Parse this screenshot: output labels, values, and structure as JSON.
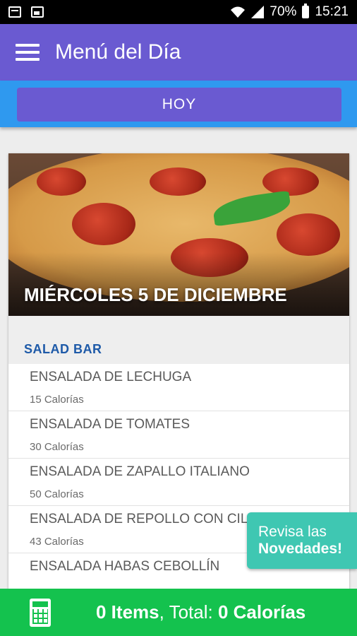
{
  "status_bar": {
    "battery": "70%",
    "time": "15:21"
  },
  "app_bar": {
    "title": "Menú del Día"
  },
  "tab": {
    "label": "HOY"
  },
  "hero": {
    "date": "MIÉRCOLES 5 DE DICIEMBRE"
  },
  "section": {
    "title": "SALAD BAR",
    "items": [
      {
        "name": "ENSALADA DE LECHUGA",
        "calories": "15 Calorías"
      },
      {
        "name": "ENSALADA DE TOMATES",
        "calories": "30 Calorías"
      },
      {
        "name": "ENSALADA DE ZAPALLO ITALIANO",
        "calories": "50 Calorías"
      },
      {
        "name": "ENSALADA DE REPOLLO CON CILANT",
        "calories": "43 Calorías"
      },
      {
        "name": "ENSALADA HABAS CEBOLLÍN",
        "calories": ""
      }
    ]
  },
  "news_button": {
    "line1": "Revisa las",
    "line2": "Novedades!"
  },
  "bottom_bar": {
    "items": "0 Items",
    "total_label": ", Total: ",
    "calories": "0 Calorías"
  },
  "colors": {
    "primary": "#6a5ad1",
    "tab_strip": "#2f99ef",
    "section_title": "#1e5aa8",
    "news": "#3fc7b2",
    "bottom_bar": "#14c24e"
  },
  "icons": [
    "calendar-icon",
    "image-icon",
    "wifi-icon",
    "signal-icon",
    "battery-icon",
    "menu-icon",
    "calculator-icon"
  ]
}
